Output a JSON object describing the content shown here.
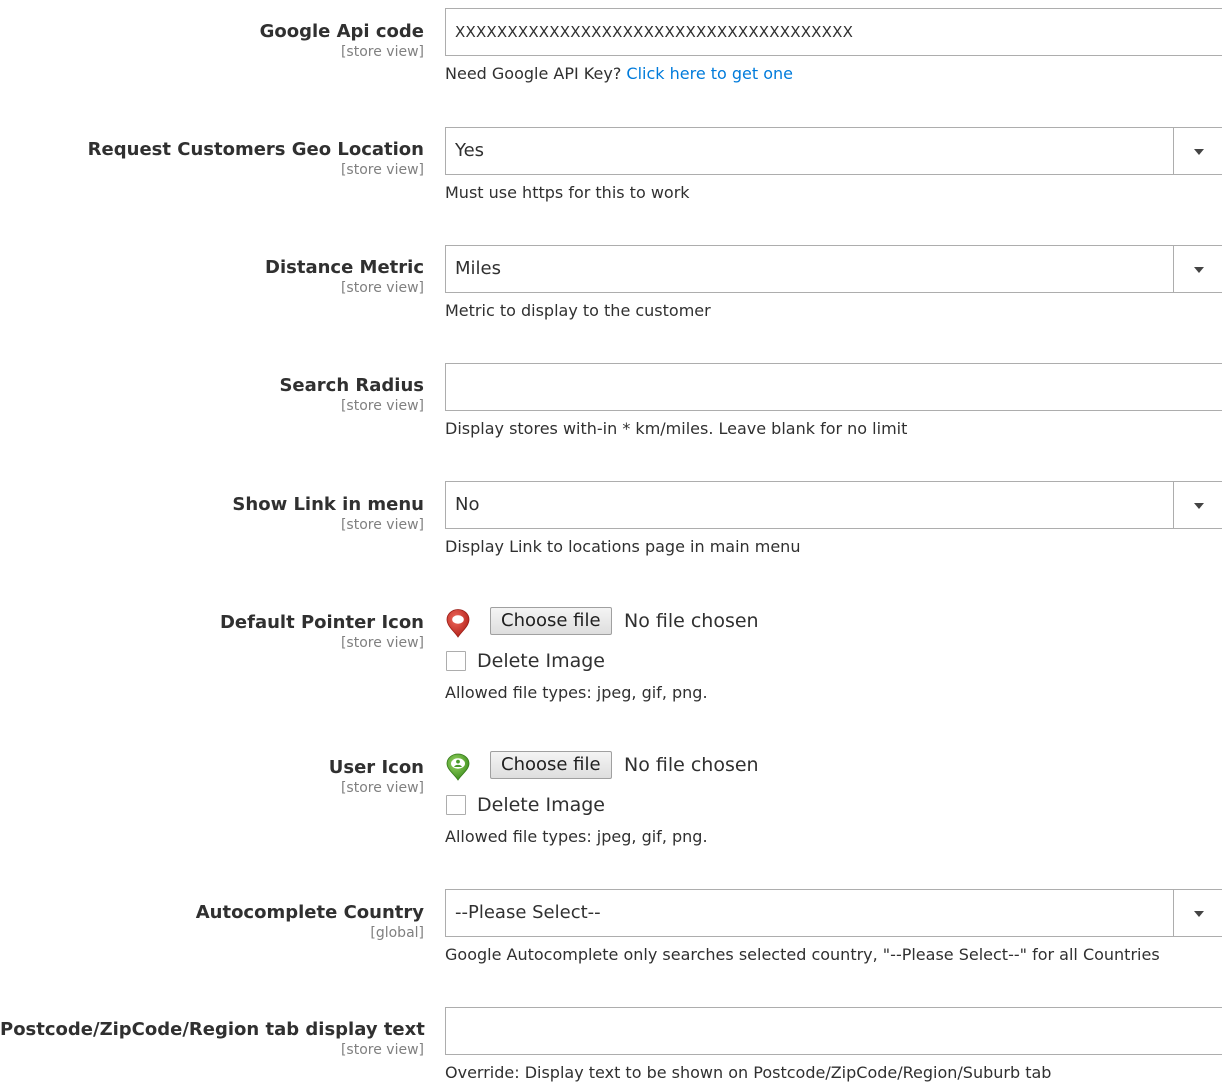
{
  "fields": {
    "google_api": {
      "label": "Google Api code",
      "scope": "[store view]",
      "value": "XXXXXXXXXXXXXXXXXXXXXXXXXXXXXXXXXXXXXX",
      "note_prefix": "Need Google API Key? ",
      "note_link": "Click here to get one"
    },
    "geo_location": {
      "label": "Request Customers Geo Location",
      "scope": "[store view]",
      "value": "Yes",
      "note": "Must use https for this to work"
    },
    "distance_metric": {
      "label": "Distance Metric",
      "scope": "[store view]",
      "value": "Miles",
      "note": "Metric to display to the customer"
    },
    "search_radius": {
      "label": "Search Radius",
      "scope": "[store view]",
      "value": "",
      "note": "Display stores with-in * km/miles. Leave blank for no limit"
    },
    "show_link": {
      "label": "Show Link in menu",
      "scope": "[store view]",
      "value": "No",
      "note": "Display Link to locations page in main menu"
    },
    "default_pointer": {
      "label": "Default Pointer Icon",
      "scope": "[store view]",
      "icon": "red-map-pin-icon",
      "icon_color": "#d9342b",
      "choose_label": "Choose file",
      "file_status": "No file chosen",
      "delete_label": "Delete Image",
      "note": "Allowed file types: jpeg, gif, png."
    },
    "user_icon": {
      "label": "User Icon",
      "scope": "[store view]",
      "icon": "green-user-pin-icon",
      "icon_color": "#5cb030",
      "choose_label": "Choose file",
      "file_status": "No file chosen",
      "delete_label": "Delete Image",
      "note": "Allowed file types: jpeg, gif, png."
    },
    "autocomplete_country": {
      "label": "Autocomplete Country",
      "scope": "[global]",
      "value": "--Please Select--",
      "note": "Google Autocomplete only searches selected country, \"--Please Select--\" for all Countries"
    },
    "postcode_text": {
      "label": "Postcode/ZipCode/Region tab display text",
      "scope": "[store view]",
      "value": "",
      "note": "Override: Display text to be shown on Postcode/ZipCode/Region/Suburb tab"
    }
  },
  "colors": {
    "link": "#007bdb",
    "label": "#303030",
    "scope": "#808080",
    "border": "#adadad"
  }
}
